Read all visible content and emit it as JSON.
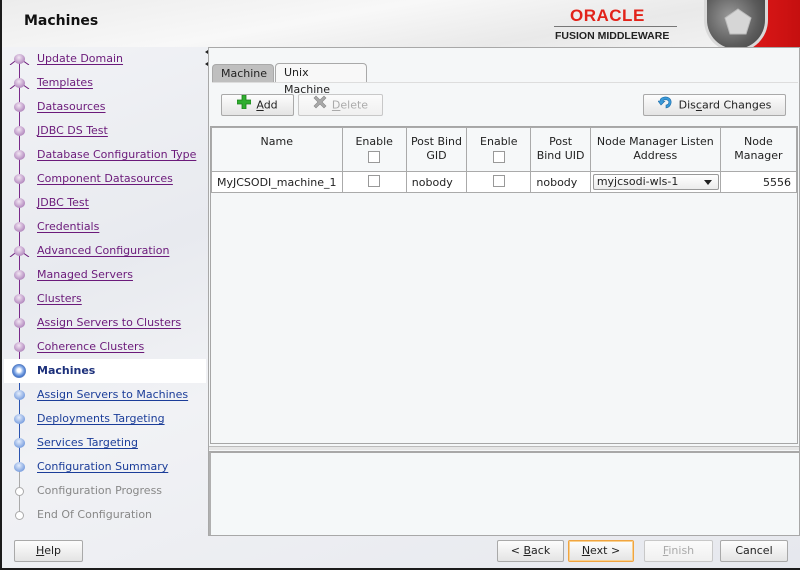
{
  "header": {
    "title": "Machines",
    "brand_top": "ORACLE",
    "brand_bottom": "FUSION MIDDLEWARE",
    "brand_color": "#e2231a"
  },
  "sidebar": {
    "items": [
      {
        "label": "Update Domain",
        "state": "done",
        "icon": "fork-node"
      },
      {
        "label": "Templates",
        "state": "done",
        "icon": "fork-node"
      },
      {
        "label": "Datasources",
        "state": "done",
        "icon": "step-dot"
      },
      {
        "label": "JDBC DS Test",
        "state": "done",
        "icon": "step-dot"
      },
      {
        "label": "Database Configuration Type",
        "state": "done",
        "icon": "step-dot"
      },
      {
        "label": "Component Datasources",
        "state": "done",
        "icon": "step-dot"
      },
      {
        "label": "JDBC Test",
        "state": "done",
        "icon": "step-dot"
      },
      {
        "label": "Credentials",
        "state": "done",
        "icon": "step-dot"
      },
      {
        "label": "Advanced Configuration",
        "state": "done",
        "icon": "fork-node"
      },
      {
        "label": "Managed Servers",
        "state": "done",
        "icon": "step-dot"
      },
      {
        "label": "Clusters",
        "state": "done",
        "icon": "step-dot"
      },
      {
        "label": "Assign Servers to Clusters",
        "state": "done",
        "icon": "step-dot"
      },
      {
        "label": "Coherence Clusters",
        "state": "done",
        "icon": "step-dot"
      },
      {
        "label": "Machines",
        "state": "current",
        "icon": "current-step-dot"
      },
      {
        "label": "Assign Servers to Machines",
        "state": "next",
        "icon": "step-dot"
      },
      {
        "label": "Deployments Targeting",
        "state": "next",
        "icon": "step-dot"
      },
      {
        "label": "Services Targeting",
        "state": "next",
        "icon": "step-dot"
      },
      {
        "label": "Configuration Summary",
        "state": "next",
        "icon": "step-dot"
      },
      {
        "label": "Configuration Progress",
        "state": "todo",
        "icon": "empty-step-dot"
      },
      {
        "label": "End Of Configuration",
        "state": "todo",
        "icon": "empty-step-dot"
      }
    ]
  },
  "tabs": [
    {
      "label": "Machine",
      "selected": false
    },
    {
      "label": "Unix Machine",
      "selected": true
    }
  ],
  "toolbar": {
    "add_label": "Add",
    "add_mnemonic": "A",
    "delete_label": "Delete",
    "delete_mnemonic": "D",
    "discard_pre": "Dis",
    "discard_mnemonic": "c",
    "discard_post": "ard Changes"
  },
  "table": {
    "columns": [
      {
        "label": "Name",
        "line2": ""
      },
      {
        "label": "Enable",
        "line2": "",
        "checkbox": true
      },
      {
        "label": "Post Bind",
        "line2": "GID"
      },
      {
        "label": "Enable",
        "line2": "",
        "checkbox": true
      },
      {
        "label": "Post",
        "line2": "Bind UID"
      },
      {
        "label": "Node Manager Listen",
        "line2": "Address"
      },
      {
        "label": "Node",
        "line2": "Manager"
      }
    ],
    "rows": [
      {
        "name": "MyJCSODI_machine_1",
        "enable_gid": false,
        "post_bind_gid": "nobody",
        "enable_uid": false,
        "post_bind_uid": "nobody",
        "listen_address": "myjcsodi-wls-1",
        "node_manager_port": "5556"
      }
    ]
  },
  "footer": {
    "help_mnemonic": "H",
    "help_rest": "elp",
    "back_pre": "< ",
    "back_mnemonic": "B",
    "back_rest": "ack",
    "next_mnemonic": "N",
    "next_rest": "ext >",
    "finish_mnemonic": "F",
    "finish_rest": "inish",
    "cancel_label": "Cancel"
  }
}
